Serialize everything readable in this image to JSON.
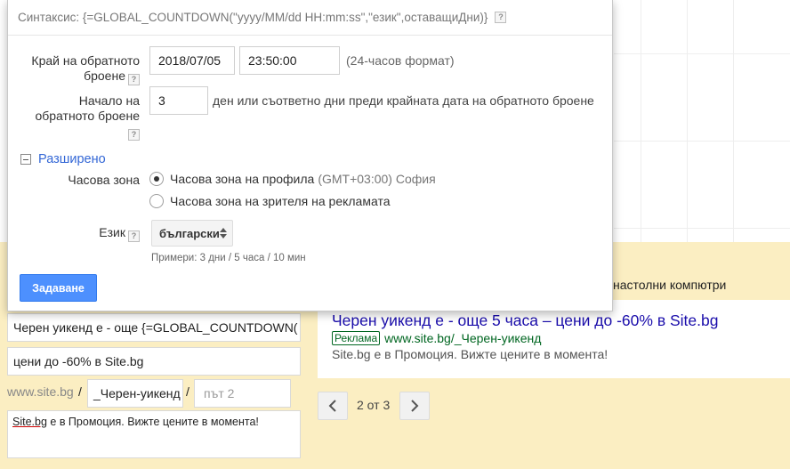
{
  "dialog": {
    "syntax": "Синтаксис: {=GLOBAL_COUNTDOWN(\"yyyy/MM/dd HH:mm:ss\",\"език\",оставащиДни)}",
    "help_glyph": "?",
    "end_label_line1": "Край на обратното",
    "end_label_line2": "броене",
    "end_date": "2018/07/05",
    "end_time": "23:50:00",
    "time_format_hint": "(24-часов формат)",
    "start_label_line1": "Начало на",
    "start_label_line2": "обратното броене",
    "start_days": "3",
    "start_hint": "ден или съответно дни преди крайната дата на обратното броене",
    "advanced_label": "Разширено",
    "timezone_label": "Часова зона",
    "tz_option_profile": "Часова зона на профила",
    "tz_option_profile_detail": "(GMT+03:00) София",
    "tz_option_viewer": "Часова зона на зрителя на рекламата",
    "language_label": "Език",
    "language_value": "български",
    "examples": "Примери: 3 дни / 5 часа / 10 мин",
    "set_button": "Задаване"
  },
  "editor": {
    "device_label": "настолни компютри",
    "headline1": "Черен уикенд е - още {=GLOBAL_COUNTDOWN(",
    "headline2": "цени до -60% в Site.bg",
    "url_prefix": "www.site.bg",
    "slash": "/",
    "path1": "_Черен-уикенд",
    "path2_placeholder": "път 2",
    "description_underlined": "Site.bg",
    "description_rest": " е в Промоция. Вижте цените в момента!"
  },
  "preview": {
    "title": "Черен уикенд е - още 5 часа – цени до -60% в Site.bg",
    "badge": "Реклама",
    "display_url": "www.site.bg/_Черен-уикенд",
    "description": "Site.bg е в Промоция. Вижте цените в момента!",
    "pager": "2 от 3"
  },
  "colors": {
    "accent_blue": "#4d90fe",
    "link_blue": "#1a0dab",
    "url_green": "#006621",
    "panel_yellow": "#fbeec2"
  },
  "icons": {
    "prev": "chevron-left-icon",
    "next": "chevron-right-icon",
    "help": "help-icon",
    "collapse": "minus-box-icon"
  }
}
